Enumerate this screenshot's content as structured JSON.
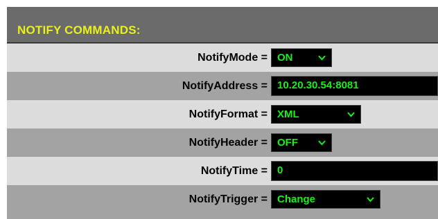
{
  "header": {
    "title": "NOTIFY COMMANDS:"
  },
  "rows": [
    {
      "label": "NotifyMode =",
      "control": "select",
      "value": "ON"
    },
    {
      "label": "NotifyAddress =",
      "control": "input",
      "value": "10.20.30.54:8081"
    },
    {
      "label": "NotifyFormat =",
      "control": "select",
      "value": "XML"
    },
    {
      "label": "NotifyHeader =",
      "control": "select",
      "value": "OFF"
    },
    {
      "label": "NotifyTime =",
      "control": "input",
      "value": "0"
    },
    {
      "label": "NotifyTrigger =",
      "control": "select",
      "value": "Change"
    }
  ],
  "colors": {
    "header_bg": "#6b6b6b",
    "header_text": "#e9f01c",
    "row_light": "#dcdcdc",
    "row_dark": "#a3a3a3",
    "control_bg": "#000000",
    "control_text": "#18f018"
  },
  "icons": {
    "dropdown": "chevron-down-icon"
  }
}
